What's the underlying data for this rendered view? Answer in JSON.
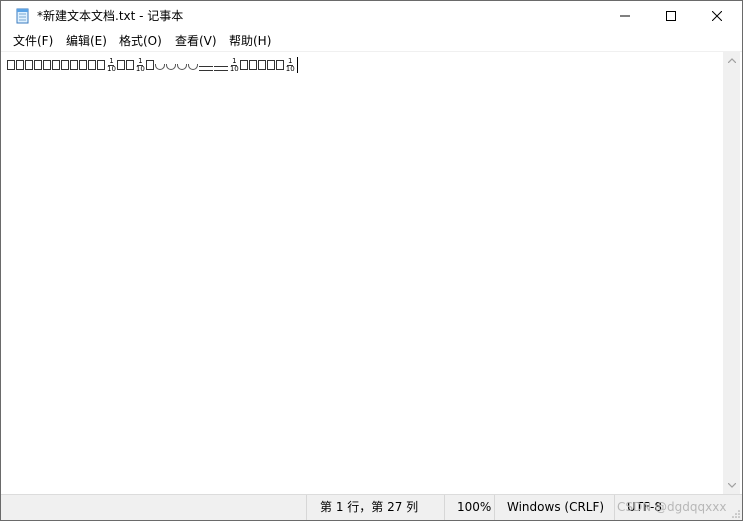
{
  "window": {
    "title": "*新建文本文档.txt - 记事本",
    "icon": "notepad-icon"
  },
  "caption_buttons": {
    "minimize": "minimize-icon",
    "maximize": "maximize-icon",
    "close": "close-icon"
  },
  "menu": [
    {
      "label": "文件(F)"
    },
    {
      "label": "编辑(E)"
    },
    {
      "label": "格式(O)"
    },
    {
      "label": "查看(V)"
    },
    {
      "label": "帮助(H)"
    }
  ],
  "editor": {
    "fraction_num": "1",
    "fraction_den": "10"
  },
  "status": {
    "position": "第 1 行，第 27 列",
    "zoom": "100%",
    "line_ending": "Windows (CRLF)",
    "encoding": "UTF-8",
    "watermark": "CSDN @dgdqqxxx"
  },
  "colors": {
    "statusbar_bg": "#f0f0f0",
    "window_border": "#6a6a6a"
  }
}
